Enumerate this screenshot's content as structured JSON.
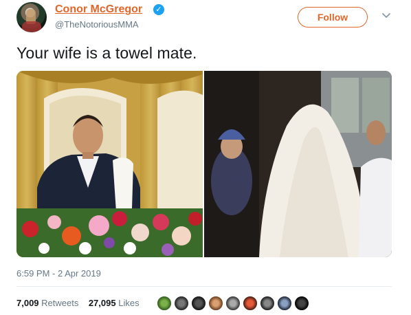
{
  "author": {
    "name": "Conor McGregor",
    "handle": "@TheNotoriousMMA",
    "verified_glyph": "✓"
  },
  "follow_button": {
    "label": "Follow"
  },
  "tweet": {
    "text": "Your wife is a towel mate.",
    "timestamp": "6:59 PM - 2 Apr 2019"
  },
  "stats": {
    "retweets_count": "7,009",
    "retweets_label": "Retweets",
    "likes_count": "27,095",
    "likes_label": "Likes"
  },
  "icons": [
    "verified-badge-icon",
    "chevron-down-icon"
  ],
  "colors": {
    "accent": "#e0662a",
    "verified": "#1da1f2",
    "muted": "#657786"
  }
}
